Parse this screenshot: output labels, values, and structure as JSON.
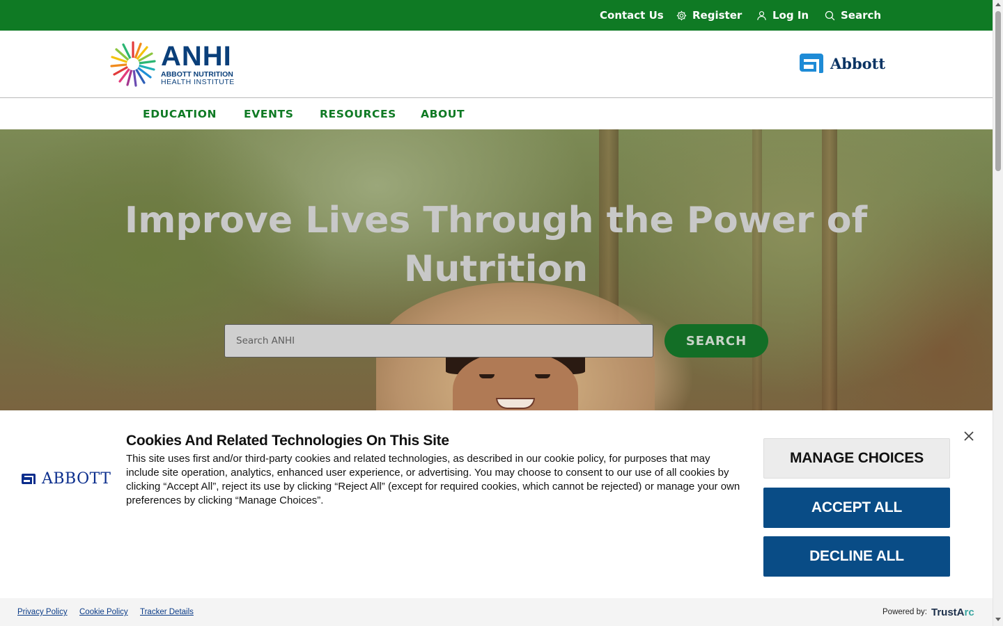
{
  "topbar": {
    "contact": "Contact Us",
    "register": "Register",
    "login": "Log In",
    "search": "Search",
    "bg_color": "#0f7a24"
  },
  "header": {
    "anhi_logo": {
      "acronym": "ANHI",
      "line1": "ABBOTT NUTRITION",
      "line2": "HEALTH INSTITUTE"
    },
    "abbott_logo": "Abbott"
  },
  "nav": {
    "items": [
      "EDUCATION",
      "EVENTS",
      "RESOURCES",
      "ABOUT"
    ]
  },
  "hero": {
    "headline_line1": "Improve Lives Through the Power of",
    "headline_line2": "Nutrition",
    "search_placeholder": "Search ANHI",
    "search_button": "SEARCH"
  },
  "cookie_banner": {
    "brand": "ABBOTT",
    "title": "Cookies And Related Technologies On This Site",
    "body": "This site uses first and/or third-party cookies and related technologies, as described in our cookie policy, for purposes that may include site operation, analytics, enhanced user experience, or advertising. You may choose to consent to our use of all cookies by clicking “Accept All”, reject its use by clicking “Reject All” (except for required cookies, which cannot be rejected) or manage your own preferences by clicking “Manage Choices”.",
    "manage_button": "MANAGE CHOICES",
    "accept_button": "ACCEPT ALL",
    "decline_button": "DECLINE ALL",
    "accent_color": "#094c86"
  },
  "cookie_footer": {
    "privacy": "Privacy Policy",
    "cookie": "Cookie Policy",
    "tracker": "Tracker Details",
    "powered_by": "Powered by:",
    "trustarc_a": "TrustA",
    "trustarc_b": "rc"
  }
}
